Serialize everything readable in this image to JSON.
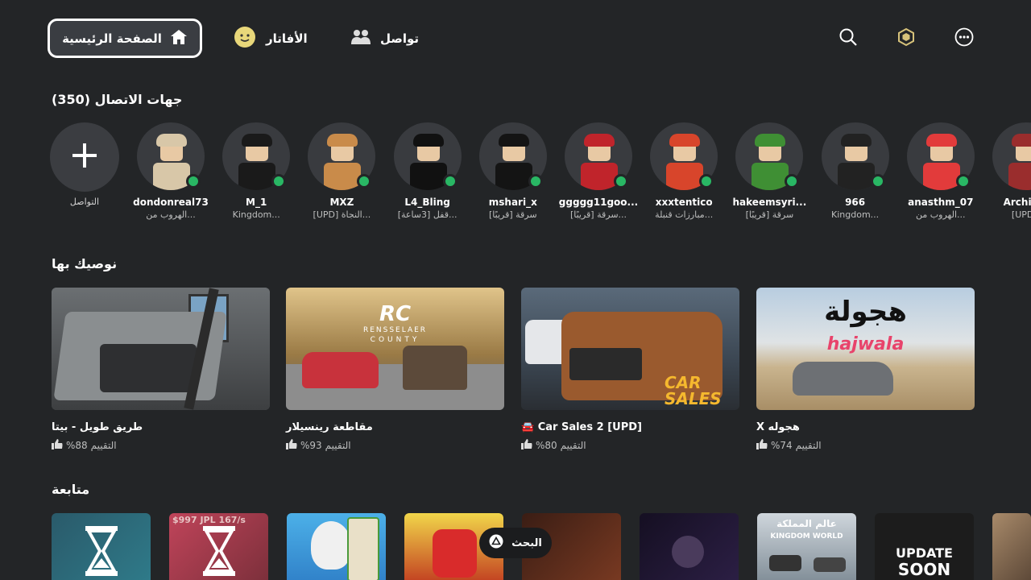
{
  "nav": {
    "home": "الصفحة الرئيسية",
    "avatar": "الأفاتار",
    "connect": "تواصل"
  },
  "contacts": {
    "title": "جهات الاتصال (350)",
    "add_label": "التواصل",
    "items": [
      {
        "name": "dondonreal73",
        "status": "الهروب من...",
        "color": "#d8c7a8"
      },
      {
        "name": "M_1",
        "status": "Kingdom...",
        "color": "#1a1a1a"
      },
      {
        "name": "MXZ",
        "status": "[UPD] النجاة...",
        "color": "#c98b4a"
      },
      {
        "name": "L4_Bling",
        "status": "قفل [3ساعة]...",
        "color": "#111111"
      },
      {
        "name": "mshari_x",
        "status": "سرقة [قريبًا]",
        "color": "#141414"
      },
      {
        "name": "ggggg11goo...",
        "status": "سرقة [قريبًا]...",
        "color": "#c0242b"
      },
      {
        "name": "xxxtentico",
        "status": "مبارزات قنبلة...",
        "color": "#d8452b"
      },
      {
        "name": "hakeemsyri...",
        "status": "سرقة [قريبًا]",
        "color": "#3f8f34"
      },
      {
        "name": "966",
        "status": "Kingdom...",
        "color": "#222222"
      },
      {
        "name": "anasthm_07",
        "status": "الهروب من...",
        "color": "#e23b3b"
      },
      {
        "name": "Archie...",
        "status": "[UPD!]",
        "color": "#9a2d2d"
      }
    ]
  },
  "recommended": {
    "title": "نوصيك بها",
    "rating_label": "التقييم",
    "games": [
      {
        "title": "طريق طويل - بيتا",
        "rating": "%88"
      },
      {
        "title": "مقاطعة رينسيلار",
        "rating": "%93"
      },
      {
        "title": "[UPD] Car Sales 2 🚘",
        "rating": "%80"
      },
      {
        "title": "هجوله X",
        "rating": "%74"
      }
    ],
    "thumb_texts": {
      "rc_logo": "RC",
      "rc_sub1": "RENSSELAER",
      "rc_sub2": "COUNTY",
      "car_sales_1": "CAR",
      "car_sales_2": "SALES",
      "hajwala_ar": "هجولة",
      "hajwala_en": "hajwala"
    }
  },
  "continue": {
    "title": "متابعة",
    "tile_texts": {
      "kingdom_ar": "عالم المملكة",
      "kingdom_en": "KINGDOM WORLD",
      "update_1": "UPDATE",
      "update_2": "SOON",
      "price_text": "$997 JPL 167/s"
    }
  },
  "search_pill": {
    "label": "البحث"
  },
  "colors": {
    "background": "#232527",
    "online": "#29b764",
    "card": "#393b3f"
  }
}
